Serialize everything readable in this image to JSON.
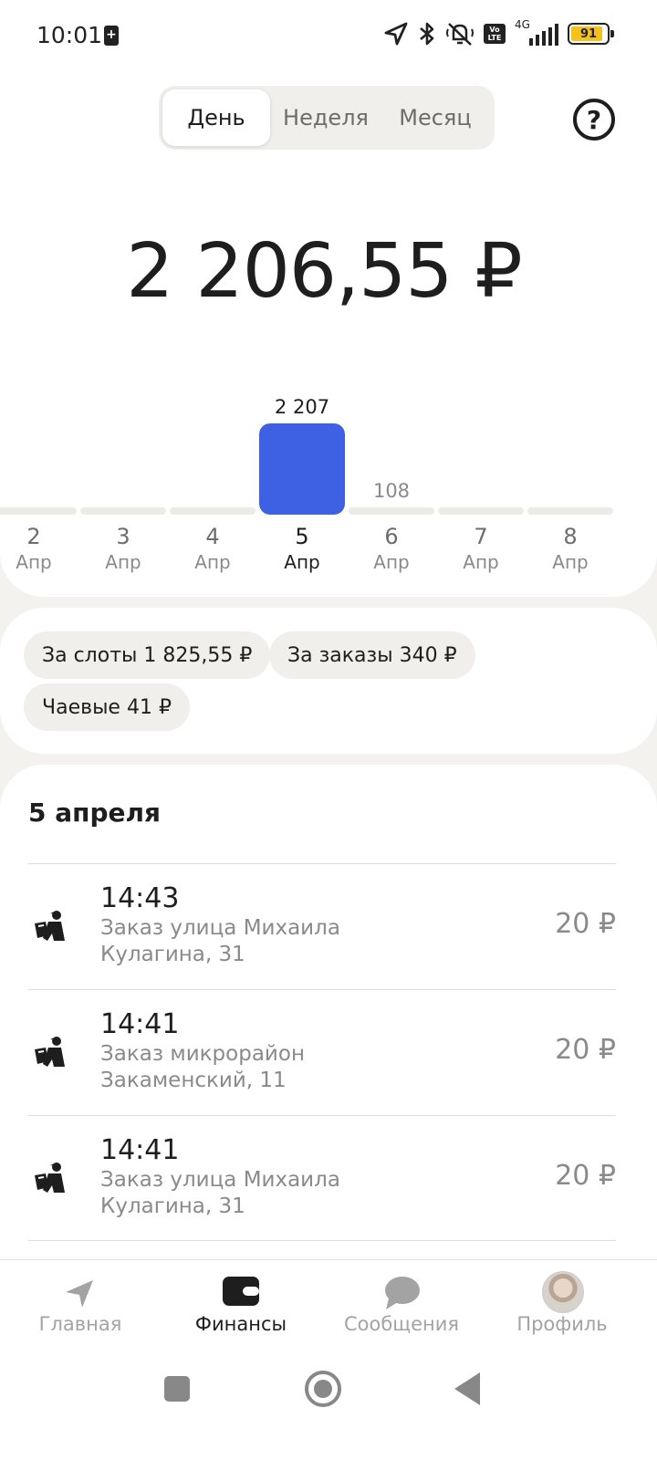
{
  "status_bar": {
    "time": "10:01",
    "network": "4G",
    "volte": "Vo LTE",
    "battery": "91"
  },
  "period_tabs": [
    {
      "label": "День",
      "active": true
    },
    {
      "label": "Неделя",
      "active": false
    },
    {
      "label": "Месяц",
      "active": false
    }
  ],
  "help_icon": "?",
  "total": "2 206,55 ₽",
  "chart_data": {
    "type": "bar",
    "categories": [
      "2 Апр",
      "3 Апр",
      "4 Апр",
      "5 Апр",
      "6 Апр",
      "7 Апр",
      "8 Апр"
    ],
    "days": [
      "2",
      "3",
      "4",
      "5",
      "6",
      "7",
      "8"
    ],
    "months": [
      "Апр",
      "Апр",
      "Апр",
      "Апр",
      "Апр",
      "Апр",
      "Апр"
    ],
    "values": [
      0,
      0,
      0,
      2207,
      108,
      0,
      0
    ],
    "value_labels": [
      "",
      "",
      "",
      "2 207",
      "108",
      "",
      ""
    ],
    "selected_index": 3,
    "selected_color": "#3e61e4",
    "bar_color": "#ecebe8"
  },
  "chips": [
    {
      "label": "За слоты 1 825,55 ₽"
    },
    {
      "label": "За заказы 340 ₽"
    },
    {
      "label": "Чаевые 41 ₽"
    }
  ],
  "list": {
    "title": "5 апреля",
    "items": [
      {
        "time": "14:43",
        "line1": "Заказ улица Михаила",
        "line2": "Кулагина, 31",
        "amount": "20 ₽",
        "icon": "courier-icon"
      },
      {
        "time": "14:41",
        "line1": "Заказ микрорайон",
        "line2": "Закаменский, 11",
        "amount": "20 ₽",
        "icon": "courier-icon"
      },
      {
        "time": "14:41",
        "line1": "Заказ улица Михаила",
        "line2": "Кулагина, 31",
        "amount": "20 ₽",
        "icon": "courier-icon"
      }
    ]
  },
  "bottom_nav": [
    {
      "label": "Главная",
      "icon": "navigation-arrow-icon",
      "active": false
    },
    {
      "label": "Финансы",
      "icon": "wallet-icon",
      "active": true
    },
    {
      "label": "Сообщения",
      "icon": "chat-bubble-icon",
      "active": false
    },
    {
      "label": "Профиль",
      "icon": "avatar",
      "active": false
    }
  ],
  "colors": {
    "accent": "#3e61e4",
    "background": "#f3f2ef",
    "card": "#ffffff",
    "muted_text": "#8a8a8a"
  }
}
